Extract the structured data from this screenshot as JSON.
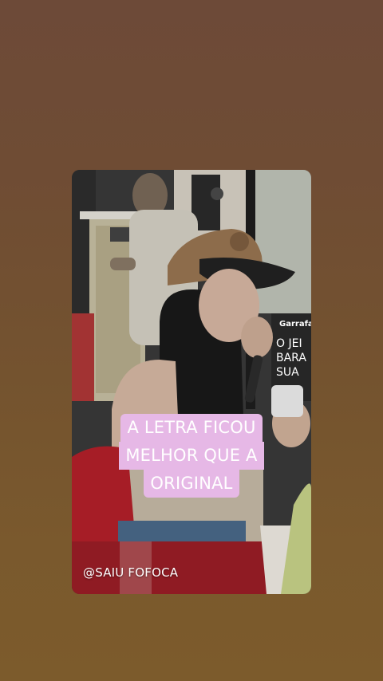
{
  "story": {
    "caption_lines": [
      "A LETRA FICOU",
      "MELHOR QUE A",
      "ORIGINAL"
    ],
    "watermark": "@SAIU FOFOCA",
    "sign": {
      "brand": "Garrafas",
      "lines": [
        "O JEI",
        "BARA",
        "SUA"
      ]
    }
  },
  "colors": {
    "background_top": "#6d4a38",
    "background_bottom": "#7c5b2c",
    "caption_highlight": "#e6b8e6",
    "caption_text": "#ffffff"
  }
}
